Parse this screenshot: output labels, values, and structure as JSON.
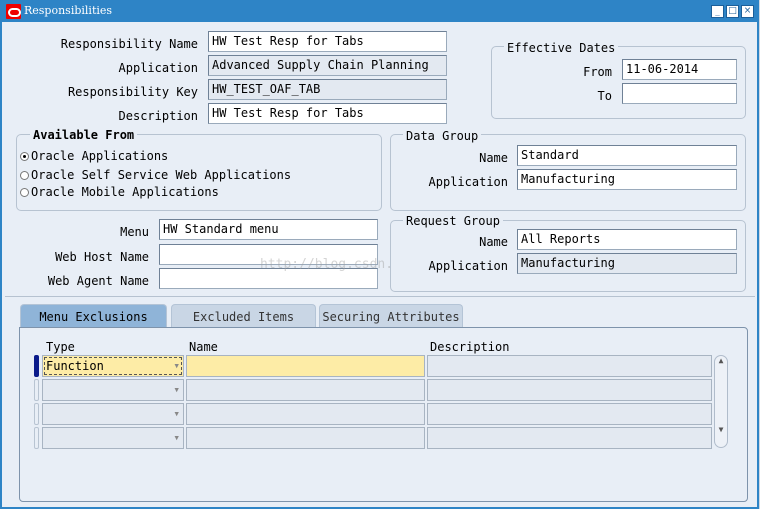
{
  "window": {
    "title": "Responsibilities"
  },
  "header_fields": [
    {
      "label": "Responsibility Name",
      "value": "HW Test Resp for Tabs"
    },
    {
      "label": "Application",
      "value": "Advanced Supply Chain Planning"
    },
    {
      "label": "Responsibility Key",
      "value": "HW_TEST_OAF_TAB"
    },
    {
      "label": "Description",
      "value": "HW Test Resp for Tabs"
    }
  ],
  "effective_dates": {
    "title": "Effective Dates",
    "from_label": "From",
    "from_value": "11-06-2014",
    "to_label": "To",
    "to_value": ""
  },
  "available_from": {
    "title": "Available From",
    "options": [
      "Oracle Applications",
      "Oracle Self Service Web Applications",
      "Oracle Mobile Applications"
    ],
    "selected": 0
  },
  "data_group": {
    "title": "Data Group",
    "name_label": "Name",
    "name_value": "Standard",
    "app_label": "Application",
    "app_value": "Manufacturing"
  },
  "menu_fields": [
    {
      "label": "Menu",
      "value": "HW Standard menu"
    },
    {
      "label": "Web Host Name",
      "value": ""
    },
    {
      "label": "Web Agent Name",
      "value": ""
    }
  ],
  "request_group": {
    "title": "Request Group",
    "name_label": "Name",
    "name_value": "All Reports",
    "app_label": "Application",
    "app_value": "Manufacturing"
  },
  "watermark": "http://blog.csdn.",
  "tabs": [
    "Menu Exclusions",
    "Excluded Items",
    "Securing Attributes"
  ],
  "table": {
    "headers": [
      "Type",
      "Name",
      "Description"
    ],
    "rows": [
      [
        "Function",
        "",
        ""
      ],
      [
        "",
        "",
        ""
      ],
      [
        "",
        "",
        ""
      ],
      [
        "",
        "",
        ""
      ]
    ]
  }
}
